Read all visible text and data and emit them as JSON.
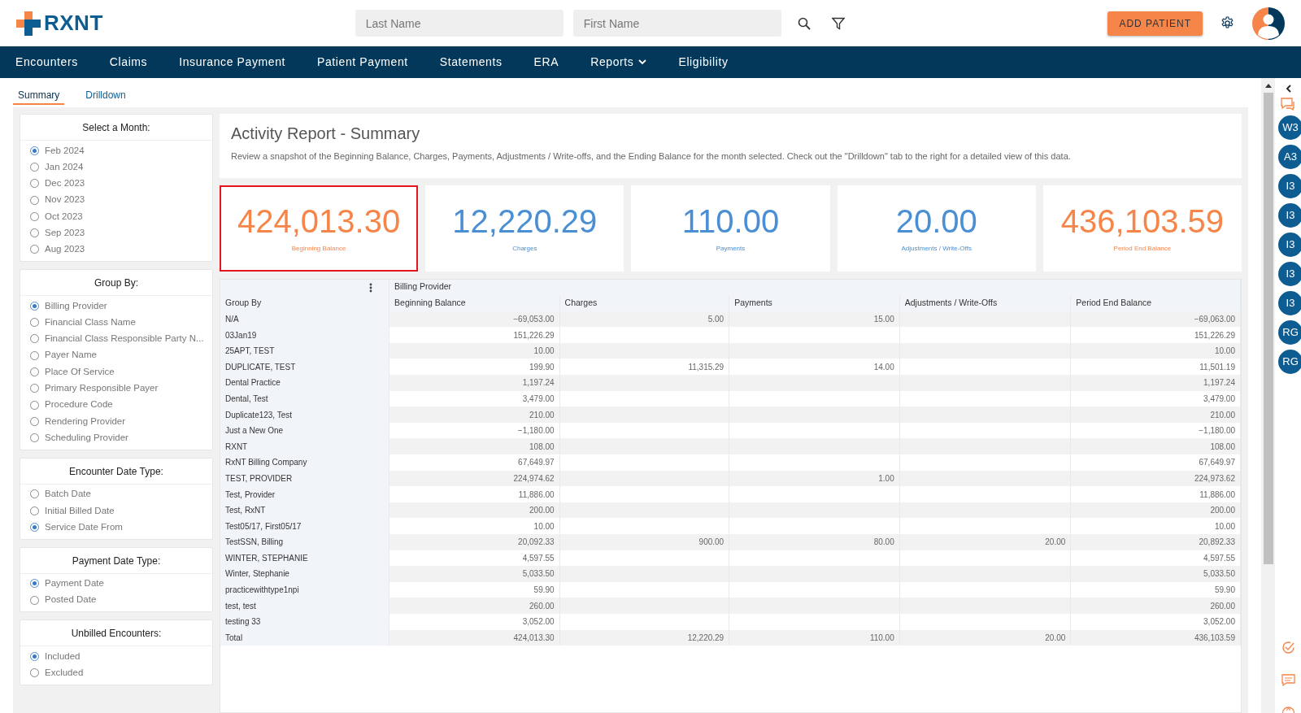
{
  "header": {
    "logo": "RXNT",
    "search_fields": [
      {
        "placeholder": "Last Name"
      },
      {
        "placeholder": "First Name"
      }
    ],
    "add_button": "ADD PATIENT"
  },
  "nav": [
    {
      "label": "Encounters",
      "dropdown": false
    },
    {
      "label": "Claims",
      "dropdown": false
    },
    {
      "label": "Insurance Payment",
      "dropdown": false
    },
    {
      "label": "Patient Payment",
      "dropdown": false
    },
    {
      "label": "Statements",
      "dropdown": false
    },
    {
      "label": "ERA",
      "dropdown": false
    },
    {
      "label": "Reports",
      "dropdown": true
    },
    {
      "label": "Eligibility",
      "dropdown": false
    }
  ],
  "tabs": [
    {
      "label": "Summary",
      "selected": true
    },
    {
      "label": "Drilldown",
      "selected": false
    }
  ],
  "filters": [
    {
      "title": "Select a Month:",
      "options": [
        {
          "label": "Feb 2024",
          "selected": true
        },
        {
          "label": "Jan 2024",
          "selected": false
        },
        {
          "label": "Dec 2023",
          "selected": false
        },
        {
          "label": "Nov 2023",
          "selected": false
        },
        {
          "label": "Oct 2023",
          "selected": false
        },
        {
          "label": "Sep 2023",
          "selected": false
        },
        {
          "label": "Aug 2023",
          "selected": false
        }
      ]
    },
    {
      "title": "Group By:",
      "options": [
        {
          "label": "Billing Provider",
          "selected": true
        },
        {
          "label": "Financial Class Name",
          "selected": false
        },
        {
          "label": "Financial Class Responsible Party N...",
          "selected": false
        },
        {
          "label": "Payer Name",
          "selected": false
        },
        {
          "label": "Place Of Service",
          "selected": false
        },
        {
          "label": "Primary Responsible Payer",
          "selected": false
        },
        {
          "label": "Procedure Code",
          "selected": false
        },
        {
          "label": "Rendering Provider",
          "selected": false
        },
        {
          "label": "Scheduling Provider",
          "selected": false
        }
      ]
    },
    {
      "title": "Encounter Date Type:",
      "options": [
        {
          "label": "Batch Date",
          "selected": false
        },
        {
          "label": "Initial Billed Date",
          "selected": false
        },
        {
          "label": "Service Date From",
          "selected": true
        }
      ]
    },
    {
      "title": "Payment Date Type:",
      "options": [
        {
          "label": "Payment Date",
          "selected": true
        },
        {
          "label": "Posted Date",
          "selected": false
        }
      ]
    },
    {
      "title": "Unbilled Encounters:",
      "options": [
        {
          "label": "Included",
          "selected": true
        },
        {
          "label": "Excluded",
          "selected": false
        }
      ]
    }
  ],
  "report": {
    "title": "Activity Report - Summary",
    "description": "Review a snapshot of the Beginning Balance, Charges, Payments, Adjustments / Write-offs, and the Ending Balance for the month selected. Check out the \"Drilldown\" tab to the right for a detailed view of this data."
  },
  "stats": [
    {
      "value": "424,013.30",
      "label": "Beginning Balance",
      "color": "#f58549",
      "selected": true
    },
    {
      "value": "12,220.29",
      "label": "Charges",
      "color": "#4a8fd4",
      "selected": false
    },
    {
      "value": "110.00",
      "label": "Payments",
      "color": "#4a8fd4",
      "selected": false
    },
    {
      "value": "20.00",
      "label": "Adjustments / Write-Offs",
      "color": "#4a8fd4",
      "selected": false
    },
    {
      "value": "436,103.59",
      "label": "Period End Balance",
      "color": "#f58549",
      "selected": false
    }
  ],
  "table": {
    "group_header": "Billing Provider",
    "columns": [
      "Group By",
      "Beginning Balance",
      "Charges",
      "Payments",
      "Adjustments / Write-Offs",
      "Period End Balance"
    ],
    "rows": [
      [
        "N/A",
        "−69,053.00",
        "5.00",
        "15.00",
        "",
        "−69,063.00"
      ],
      [
        "03Jan19",
        "151,226.29",
        "",
        "",
        "",
        "151,226.29"
      ],
      [
        "25APT, TEST",
        "10.00",
        "",
        "",
        "",
        "10.00"
      ],
      [
        "DUPLICATE, TEST",
        "199.90",
        "11,315.29",
        "14.00",
        "",
        "11,501.19"
      ],
      [
        "Dental Practice",
        "1,197.24",
        "",
        "",
        "",
        "1,197.24"
      ],
      [
        "Dental, Test",
        "3,479.00",
        "",
        "",
        "",
        "3,479.00"
      ],
      [
        "Duplicate123, Test",
        "210.00",
        "",
        "",
        "",
        "210.00"
      ],
      [
        "Just a New One",
        "−1,180.00",
        "",
        "",
        "",
        "−1,180.00"
      ],
      [
        "RXNT",
        "108.00",
        "",
        "",
        "",
        "108.00"
      ],
      [
        "RxNT Billing Company",
        "67,649.97",
        "",
        "",
        "",
        "67,649.97"
      ],
      [
        "TEST, PROVIDER",
        "224,974.62",
        "",
        "1.00",
        "",
        "224,973.62"
      ],
      [
        "Test, Provider",
        "11,886.00",
        "",
        "",
        "",
        "11,886.00"
      ],
      [
        "Test, RxNT",
        "200.00",
        "",
        "",
        "",
        "200.00"
      ],
      [
        "Test05/17, First05/17",
        "10.00",
        "",
        "",
        "",
        "10.00"
      ],
      [
        "TestSSN, Billing",
        "20,092.33",
        "900.00",
        "80.00",
        "20.00",
        "20,892.33"
      ],
      [
        "WINTER, STEPHANIE",
        "4,597.55",
        "",
        "",
        "",
        "4,597.55"
      ],
      [
        "Winter, Stephanie",
        "5,033.50",
        "",
        "",
        "",
        "5,033.50"
      ],
      [
        "practicewithtype1npi",
        "59.90",
        "",
        "",
        "",
        "59.90"
      ],
      [
        "test, test",
        "260.00",
        "",
        "",
        "",
        "260.00"
      ],
      [
        "testing 33",
        "3,052.00",
        "",
        "",
        "",
        "3,052.00"
      ]
    ],
    "total": [
      "Total",
      "424,013.30",
      "12,220.29",
      "110.00",
      "20.00",
      "436,103.59"
    ]
  },
  "sidebar": {
    "avatars": [
      "W3",
      "A3",
      "I3",
      "I3",
      "I3",
      "I3",
      "I3",
      "RG",
      "RG"
    ]
  }
}
